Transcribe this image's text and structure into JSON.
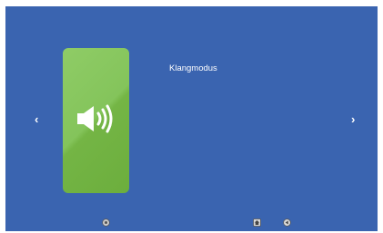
{
  "screen": {
    "mode_label": "Klangmodus",
    "card_icon": "speaker-volume-icon",
    "nav": {
      "left_arrow": "‹",
      "right_arrow": "›"
    },
    "bottom_bar": [
      "settings-icon",
      "home-icon",
      "back-icon"
    ]
  },
  "colors": {
    "background": "#3a64b0",
    "card": "#7fbf55",
    "text": "#ffffff"
  }
}
